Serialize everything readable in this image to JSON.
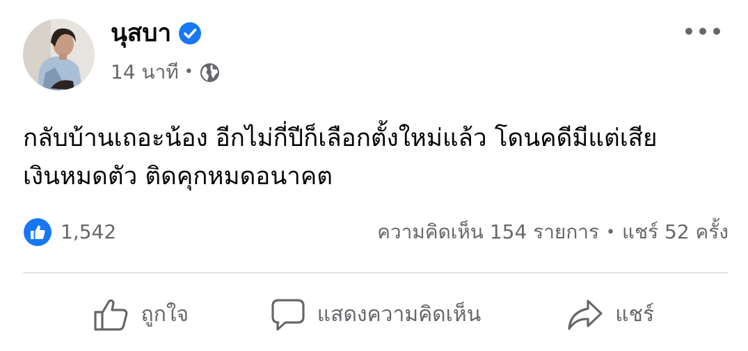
{
  "post": {
    "author": "นุสบา",
    "verified": true,
    "time": "14 นาที",
    "meta_separator": "•",
    "audience_icon": "globe-icon",
    "text_lines": [
      "กลับบ้านเถอะน้อง อีกไม่กี่ปีก็เลือกตั้งใหม่แล้ว โดนคดีมีแต่เสีย",
      "เงินหมดตัว ติดคุกหมดอนาคต"
    ]
  },
  "stats": {
    "reaction_icon": "like-reaction-icon",
    "reaction_count": "1,542",
    "comments": "ความคิดเห็น 154 รายการ",
    "separator": "•",
    "shares": "แชร์ 52 ครั้ง"
  },
  "actions": {
    "like": "ถูกใจ",
    "comment": "แสดงความคิดเห็น",
    "share": "แชร์"
  },
  "colors": {
    "brand_blue": "#1877f2",
    "secondary_text": "#65676b",
    "primary_text": "#050505",
    "divider": "#ced0d4"
  }
}
